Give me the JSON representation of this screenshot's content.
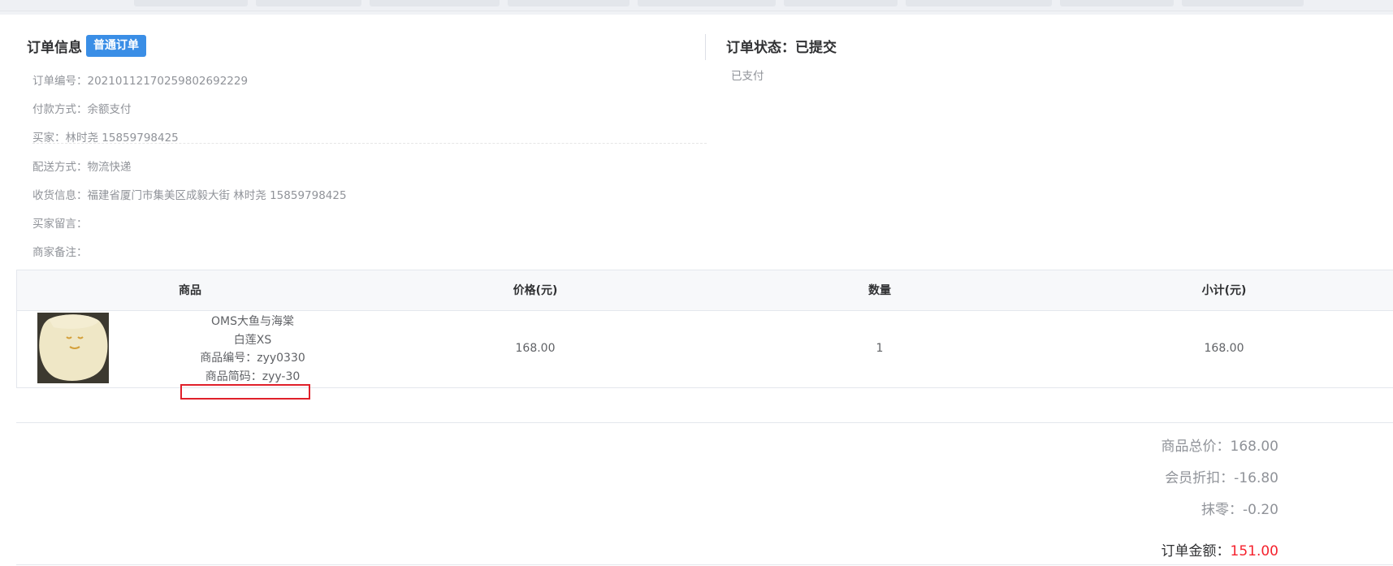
{
  "order_info": {
    "title": "订单信息",
    "type_tag": "普通订单",
    "order_no": "订单编号：20210112170259802692229",
    "payment": "付款方式：余额支付",
    "buyer": "买家：林时尧  15859798425",
    "delivery": "配送方式：物流快递",
    "shipping": "收货信息：福建省厦门市集美区成毅大街  林时尧  15859798425",
    "buyer_message": "买家留言：",
    "merchant_note": "商家备注："
  },
  "order_status": {
    "title": "订单状态：已提交",
    "sub": "已支付"
  },
  "table": {
    "headers": [
      "商品",
      "价格(元)",
      "数量",
      "小计(元)"
    ],
    "rows": [
      {
        "thumbnail": "product-photo",
        "name": "OMS大鱼与海棠",
        "spec": "白莲XS",
        "code": "商品编号：zyy0330",
        "short_code": "商品简码：zyy-30",
        "price": "168.00",
        "quantity": "1",
        "subtotal": "168.00"
      }
    ]
  },
  "summary": {
    "goods_total": "商品总价：168.00",
    "member_discount": "会员折扣：-16.80",
    "rounding": "抹零：-0.20",
    "order_amount_label": "订单金额：",
    "order_amount_value": "151.00"
  },
  "colors": {
    "tag": "#3a8ee6",
    "highlight": "#e0202a",
    "amount": "#f5222d"
  }
}
